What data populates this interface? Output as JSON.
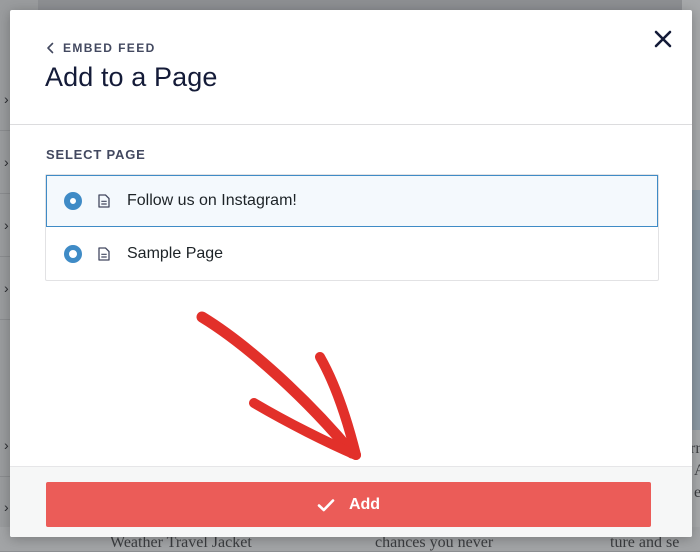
{
  "modal": {
    "back_label": "EMBED FEED",
    "title": "Add to a Page",
    "section_label": "SELECT PAGE",
    "pages": [
      {
        "label": "Follow us on Instagram!",
        "selected": true
      },
      {
        "label": "Sample Page",
        "selected": false
      }
    ],
    "add_button_label": "Add"
  },
  "background": {
    "right_fragments": [
      "a",
      "rr",
      "A",
      "e",
      "se"
    ],
    "bottom_fragments": [
      "Weather Travel Jacket",
      "chances you never",
      "ture and se"
    ]
  },
  "colors": {
    "accent_blue": "#3f8bc6",
    "add_button": "#eb5c58",
    "annotation_arrow": "#e2302a",
    "title_text": "#141b38"
  },
  "icons": {
    "back": "chevron-left-icon",
    "close": "close-icon",
    "page": "document-icon",
    "confirm": "checkmark-icon",
    "annotation": "hand-drawn-arrow"
  }
}
